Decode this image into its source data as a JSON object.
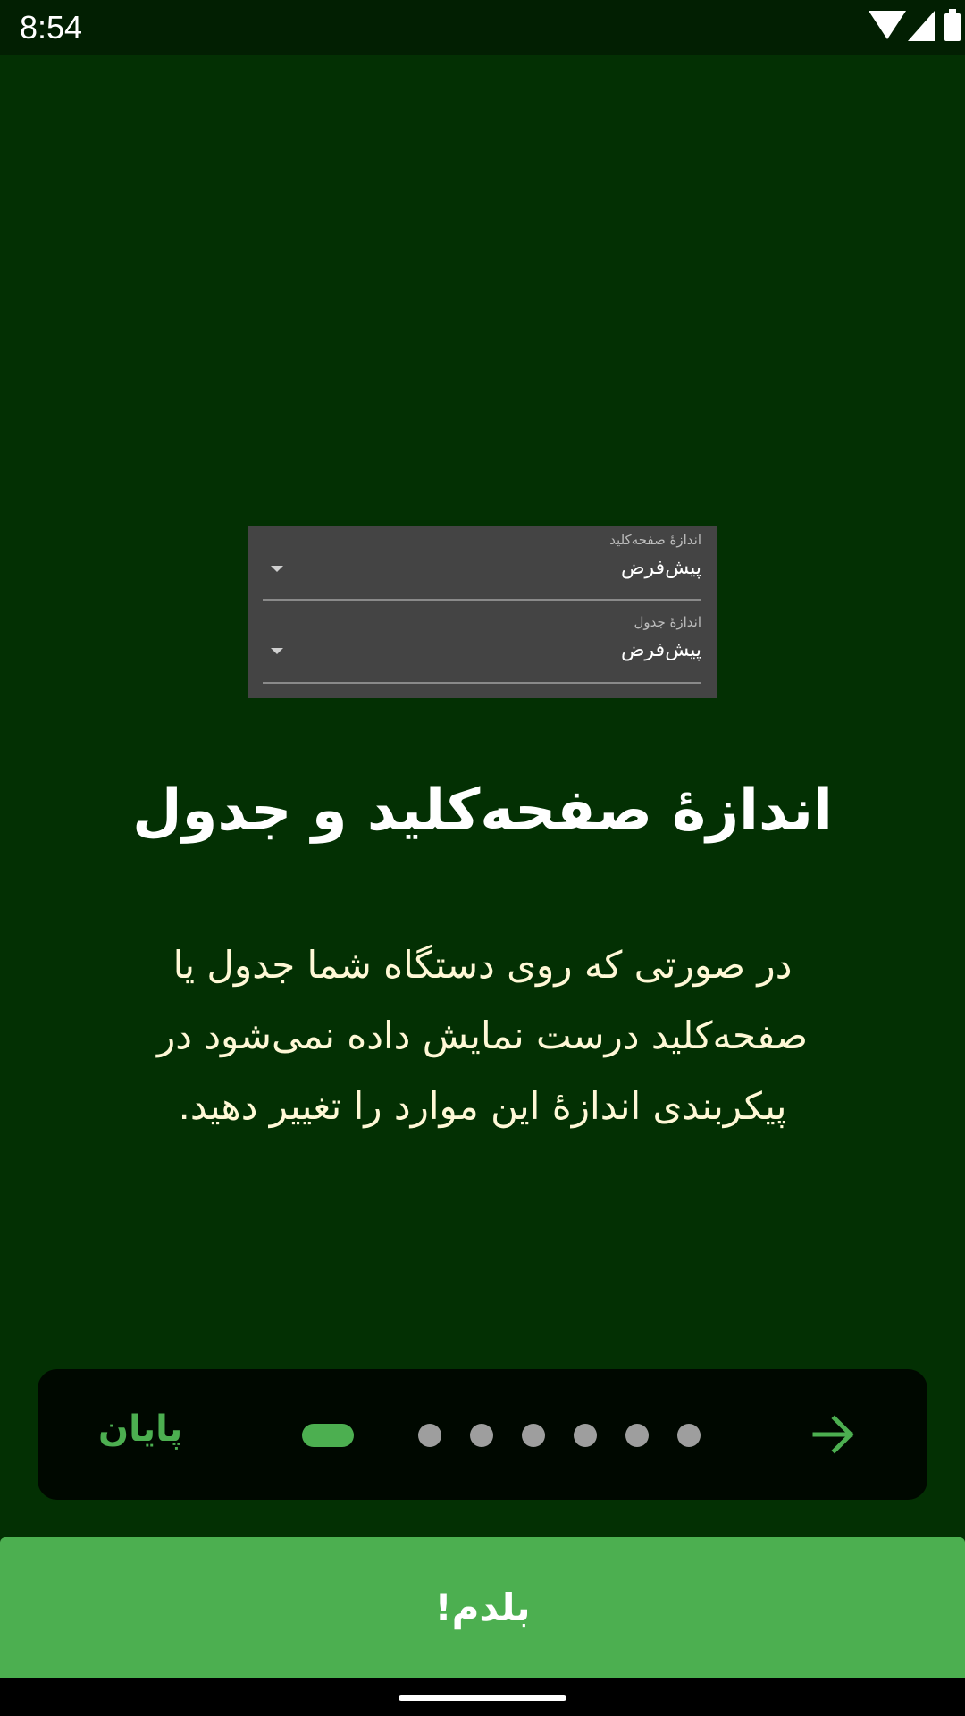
{
  "status_bar": {
    "time": "8:54"
  },
  "preview": {
    "keyboard_size": {
      "label": "اندازهٔ صفحه‌کلید",
      "value": "پیش‌فرض"
    },
    "table_size": {
      "label": "اندازهٔ جدول",
      "value": "پیش‌فرض"
    }
  },
  "headline": "اندازهٔ صفحه‌کلید و جدول",
  "body": {
    "line1": "در صورتی که روی دستگاه شما جدول یا",
    "line2": "صفحه‌کلید درست نمایش داده نمی‌شود در",
    "line3": "پیکربندی اندازهٔ این موارد را تغییر دهید."
  },
  "navigation": {
    "finish_label": "پایان",
    "page_count": 7,
    "current_page": 1,
    "next_icon": "arrow-right-icon"
  },
  "cta": {
    "label": "بلدم!"
  },
  "colors": {
    "background": "#033003",
    "accent": "#4caf50",
    "body_text": "#fff8d6",
    "card": "#000800",
    "dot_inactive": "#9e9e9e"
  }
}
